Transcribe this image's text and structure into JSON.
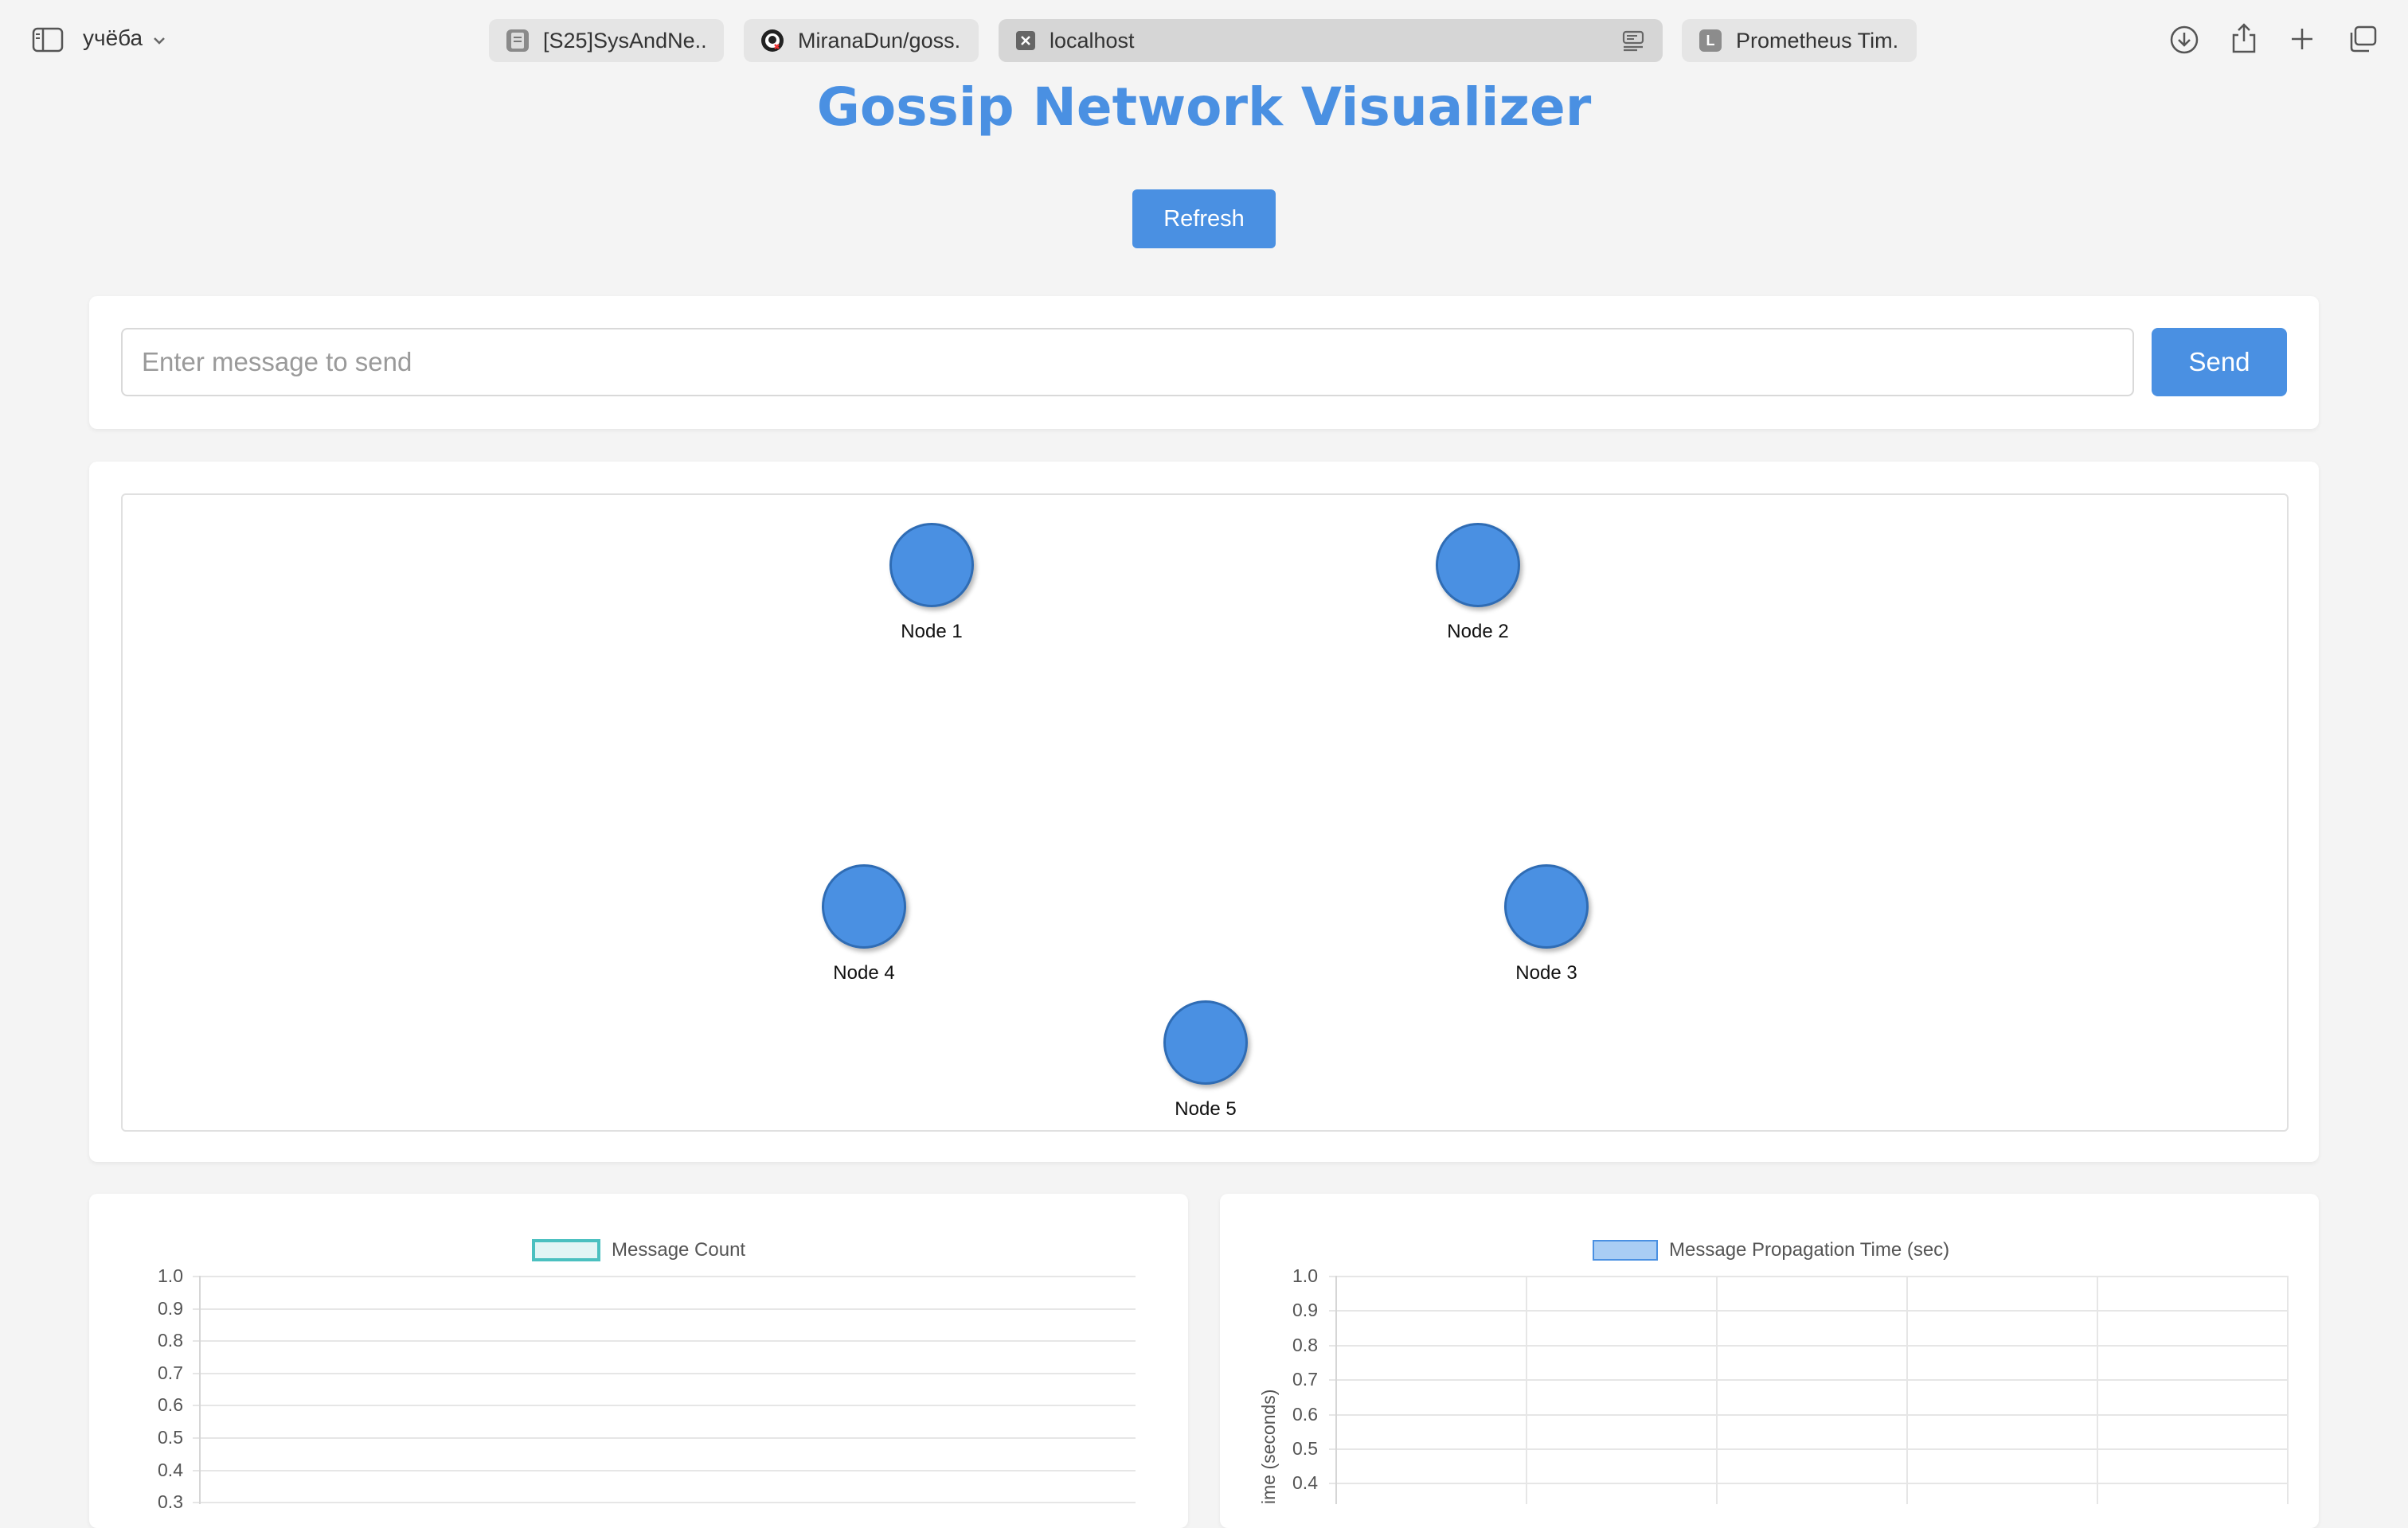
{
  "browser": {
    "profile_label": "учёба",
    "tabs": [
      {
        "label": "[S25]SysAndNe..."
      },
      {
        "label": "MiranaDun/goss..."
      },
      {
        "label": "localhost"
      },
      {
        "label": "Prometheus Tim...",
        "favicon_letter": "L"
      }
    ]
  },
  "page": {
    "title": "Gossip Network Visualizer",
    "refresh_label": "Refresh",
    "message": {
      "placeholder": "Enter message to send",
      "value": "",
      "send_label": "Send"
    }
  },
  "network": {
    "nodes": [
      {
        "label": "Node 1"
      },
      {
        "label": "Node 2"
      },
      {
        "label": "Node 3"
      },
      {
        "label": "Node 4"
      },
      {
        "label": "Node 5"
      }
    ]
  },
  "chart_data": [
    {
      "type": "bar",
      "legend": [
        "Message Count"
      ],
      "series": [
        {
          "name": "Message Count",
          "values": [],
          "color": "#4bc0c0"
        }
      ],
      "ylabel": "",
      "ylim": [
        0,
        1.0
      ],
      "y_ticks": [
        "1.0",
        "0.9",
        "0.8",
        "0.7",
        "0.6",
        "0.5",
        "0.4",
        "0.3"
      ],
      "grid": true
    },
    {
      "type": "bar",
      "legend": [
        "Message Propagation Time (sec)"
      ],
      "series": [
        {
          "name": "Message Propagation Time (sec)",
          "values": [],
          "color": "#4a90e2"
        }
      ],
      "ylabel": "ime (seconds)",
      "ylim": [
        0,
        1.0
      ],
      "y_ticks": [
        "1.0",
        "0.9",
        "0.8",
        "0.7",
        "0.6",
        "0.5",
        "0.4"
      ],
      "grid": true
    }
  ],
  "colors": {
    "accent": "#4a90e2",
    "page_bg": "#f4f4f4",
    "node_border": "#2f6cb4",
    "count_series": "#4bc0c0"
  }
}
